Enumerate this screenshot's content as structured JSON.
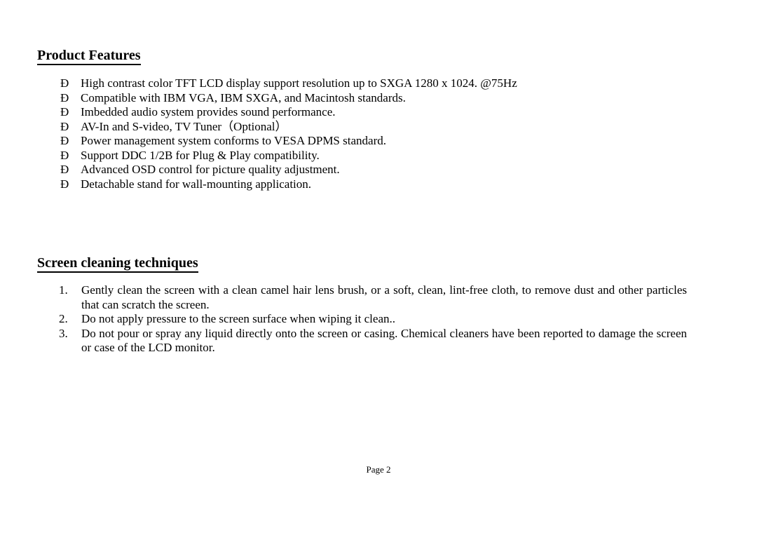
{
  "document": {
    "page_label": "Page 2",
    "background_color": "#ffffff",
    "text_color": "#000000"
  },
  "sections": [
    {
      "id": "product-features",
      "heading": "Product Features",
      "bullet_marker": "Ð",
      "items": [
        "High contrast color TFT LCD display support resolution up to SXGA 1280 x 1024. @75Hz",
        "Compatible with IBM VGA, IBM SXGA, and Macintosh standards.",
        "Imbedded audio system provides sound performance.",
        "AV-In and S-video, TV Tuner（Optional）",
        "Power management system conforms to VESA DPMS standard.",
        "Support DDC 1/2B for Plug & Play compatibility.",
        "Advanced OSD control for picture quality adjustment.",
        "Detachable stand for wall-mounting application."
      ]
    },
    {
      "id": "screen-cleaning-techniques",
      "heading": "Screen cleaning techniques",
      "items": [
        {
          "number": "1.",
          "text": "Gently clean the screen with a clean camel hair lens brush, or a soft, clean, lint-free cloth, to remove dust and other particles that can scratch the screen."
        },
        {
          "number": "2.",
          "text": "Do not apply pressure to the screen surface when wiping it clean.."
        },
        {
          "number": "3.",
          "text": "Do not pour or spray any liquid directly onto the screen or casing. Chemical cleaners have been reported to damage the screen or case of the LCD monitor."
        }
      ]
    }
  ]
}
